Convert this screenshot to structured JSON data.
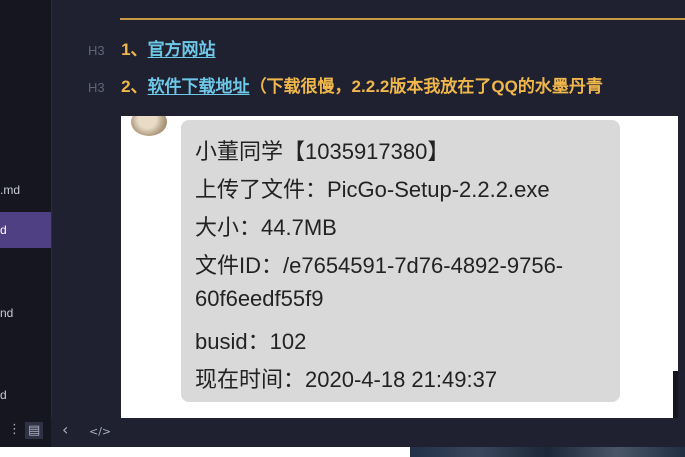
{
  "sidebar": {
    "items": [
      {
        "label": ".md"
      },
      {
        "label": "d",
        "active": true
      },
      {
        "label": "nd"
      },
      {
        "label": "d"
      }
    ]
  },
  "editor": {
    "headings": [
      {
        "tag": "H3",
        "prefix": "1、",
        "link": "官方网站",
        "suffix": ""
      },
      {
        "tag": "H3",
        "prefix": "2、",
        "link": "软件下载地址",
        "suffix": "（下载很慢，2.2.2版本我放在了QQ的水墨丹青"
      }
    ]
  },
  "chat_image": {
    "sender": "小董同学",
    "lines": [
      "小董同学【1035917380】",
      "上传了文件：PicGo-Setup-2.2.2.exe",
      "大小：44.7MB",
      "文件ID：/e7654591-7d76-4892-9756-",
      "60f6eedf55f9",
      "busid：102",
      "现在时间：2020-4-18 21:49:37"
    ]
  },
  "bottombar": {
    "more_icon": "⋮",
    "outline_icon": "▤",
    "back_icon": "‹",
    "source_icon": "</>"
  },
  "colors": {
    "heading": "#f0b74b",
    "link": "#6ec8e8",
    "accent_bar": "#c79a43",
    "active_item": "#4f3f83"
  }
}
